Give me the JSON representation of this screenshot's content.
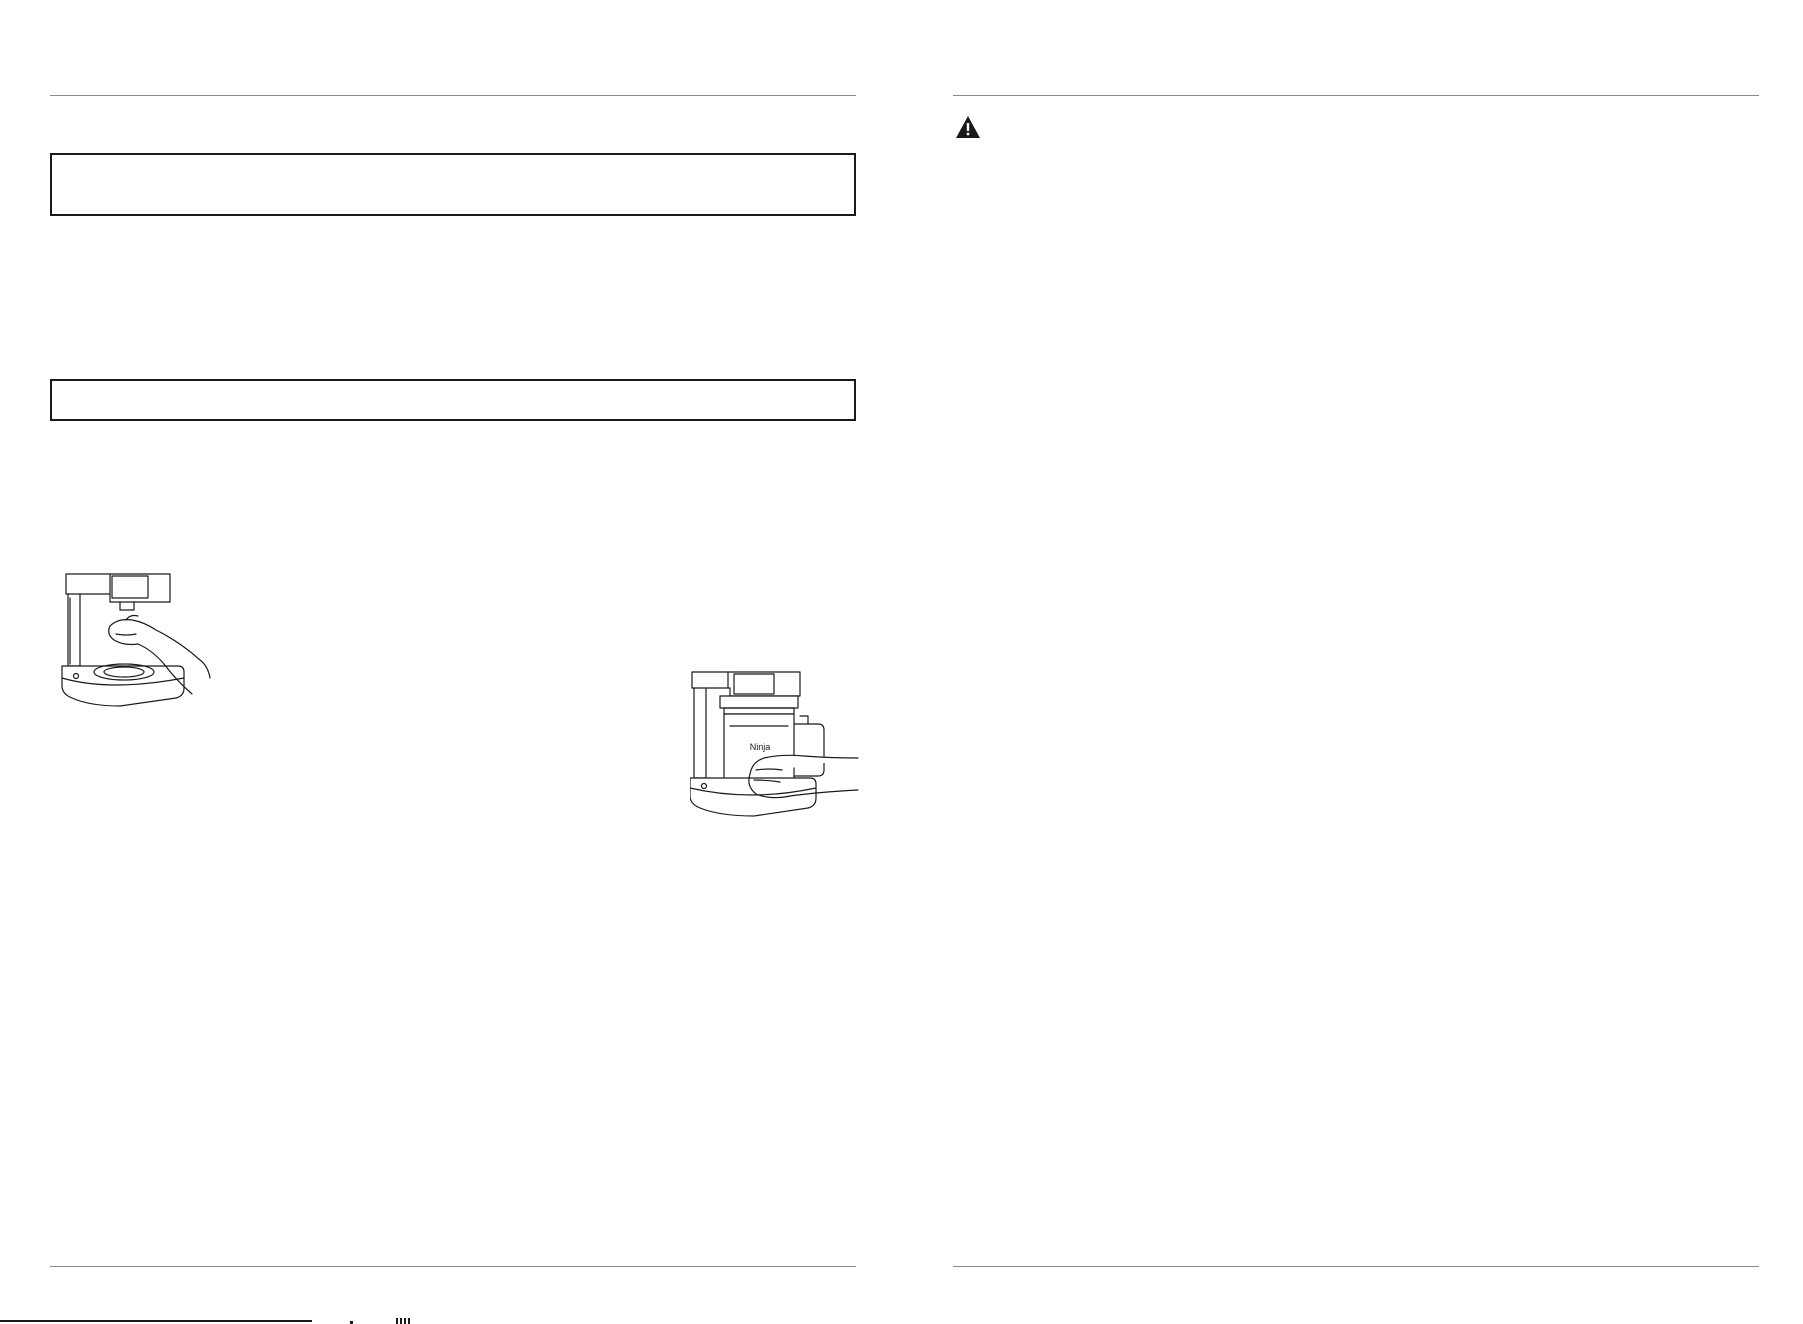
{
  "document": {
    "layout": "two-page-spread",
    "left_page": {
      "panels": [
        "boxed-panel-large",
        "boxed-panel-small"
      ],
      "illustrations": [
        {
          "name": "hand-pressing-button-illustration"
        },
        {
          "name": "hand-placing-pitcher-illustration",
          "brand_mark": "Ninja"
        }
      ]
    },
    "right_page": {
      "icons": [
        "warning-icon"
      ]
    }
  },
  "colors": {
    "ink": "#1a1a1a",
    "rule": "#8a8a8a",
    "paper": "#ffffff"
  }
}
